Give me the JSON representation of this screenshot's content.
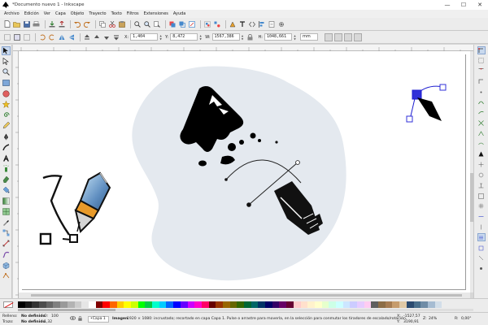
{
  "window": {
    "title": "*Documento nuevo 1 - Inkscape",
    "minimize": "—",
    "maximize": "☐",
    "close": "✕"
  },
  "menu": [
    "Archivo",
    "Edición",
    "Ver",
    "Capa",
    "Objeto",
    "Trayecto",
    "Texto",
    "Filtros",
    "Extensiones",
    "Ayuda"
  ],
  "toolcontrols": {
    "x_label": "X:",
    "x_value": "1,404",
    "y_label": "Y:",
    "y_value": "8,472",
    "w_label": "W:",
    "w_value": "1567,386",
    "h_label": "H:",
    "h_value": "1048,661",
    "unit": "mm"
  },
  "icons": {
    "tools": [
      "selector-icon",
      "node-icon",
      "zoom-icon",
      "rectangle-icon",
      "circle-icon",
      "star-icon",
      "spiral-icon",
      "pencil-icon",
      "pen-icon",
      "calligraphy-icon",
      "text-icon",
      "spray-icon",
      "eraser-icon",
      "paint-bucket-icon",
      "gradient-icon",
      "mesh-icon",
      "dropper-icon",
      "connector-icon",
      "measure-icon",
      "tweak-icon",
      "3dbox-icon",
      "lpe-icon"
    ],
    "snaps": [
      "snap-enable-icon",
      "snap-bbox-icon",
      "snap-bbox-edge-icon",
      "snap-bbox-corner-icon",
      "snap-bbox-midpoint-icon",
      "snap-nodes-icon",
      "snap-path-icon",
      "snap-intersection-icon",
      "snap-cusp-icon",
      "snap-smooth-icon",
      "snap-midpoint-icon",
      "snap-object-center-icon",
      "snap-rotation-icon",
      "snap-text-baseline-icon",
      "snap-page-icon",
      "snap-grid-icon",
      "snap-guide-icon",
      "snap-others-icon",
      "snap-extra-1-icon",
      "snap-extra-2-icon",
      "snap-extra-3-icon",
      "snap-extra-4-icon"
    ]
  },
  "palette_colors": [
    "#000000",
    "#1a1a1a",
    "#333333",
    "#4d4d4d",
    "#666666",
    "#808080",
    "#999999",
    "#b3b3b3",
    "#cccccc",
    "#e6e6e6",
    "#ffffff",
    "#800000",
    "#ff0000",
    "#ff6600",
    "#ffcc00",
    "#ffff00",
    "#ccff00",
    "#00ff00",
    "#00cc44",
    "#00ffcc",
    "#00ccff",
    "#0066ff",
    "#0000ff",
    "#6600ff",
    "#cc00ff",
    "#ff00cc",
    "#ff0066",
    "#660000",
    "#993300",
    "#996600",
    "#666600",
    "#336600",
    "#006633",
    "#006666",
    "#003366",
    "#000066",
    "#330066",
    "#660066",
    "#660033",
    "#ffcccc",
    "#ffe0cc",
    "#fff2cc",
    "#ffffcc",
    "#e6ffcc",
    "#ccffe6",
    "#ccffff",
    "#cce6ff",
    "#ccccff",
    "#e6ccff",
    "#ffccf2",
    "#5f5f5f",
    "#8c6d46",
    "#a67c52",
    "#c69c6d",
    "#e0c9a6",
    "#2b4a6f",
    "#4a6f8c",
    "#6f8ca6",
    "#a6bcd2",
    "#d2dee9"
  ],
  "status": {
    "fill_label": "Relleno:",
    "fill_value": "No definido",
    "stroke_label": "Trazo:",
    "stroke_value": "No definido",
    "opacity_label": "O:",
    "opacity_value": "100",
    "stroke_width": "1,32",
    "layer": "•Capa 1",
    "message_type": "Imagen",
    "message": "1920 × 1080: incrustado; recortado en capa Capa 1. Pulse o arrastre para moverla, en la selección para conmutar los tiradores de escalado/rotación.",
    "x_label": "X:",
    "x_value": "-1527,57",
    "y_label": "Y:",
    "y_value": "3190,91",
    "z_label": "Z:",
    "zoom": "24%",
    "r_label": "R:",
    "rotation": "0,00°"
  }
}
